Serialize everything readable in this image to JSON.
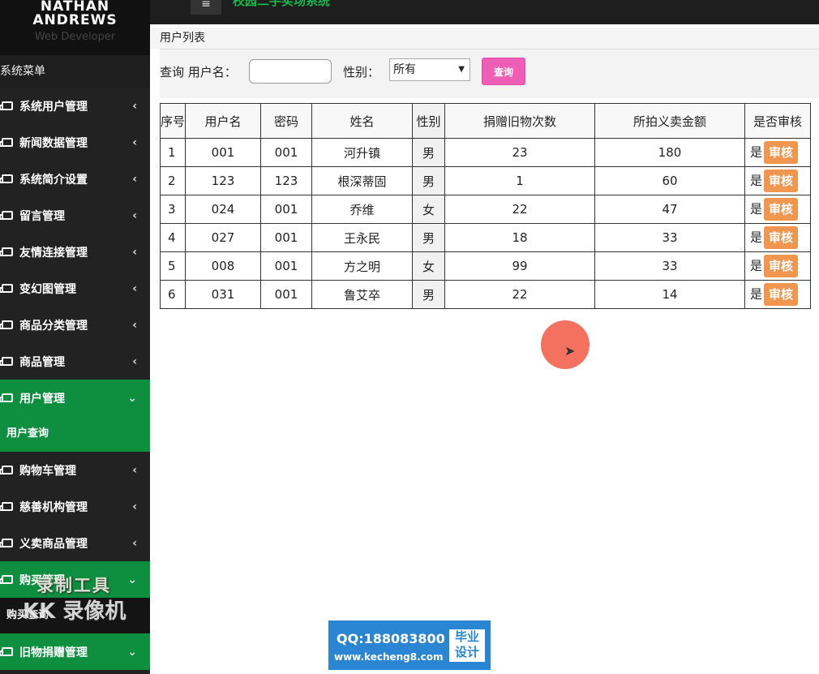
{
  "brand": {
    "name_line1": "NATHAN",
    "name_line2": "ANDREWS",
    "role": "Web Developer"
  },
  "topbar": {
    "toggle_icon": "≡",
    "title": "校园二手买场系统"
  },
  "sidebar": {
    "title": "系统菜单",
    "items": [
      {
        "label": "系统用户管理",
        "chevron": "‹"
      },
      {
        "label": "新闻数据管理",
        "chevron": "‹"
      },
      {
        "label": "系统简介设置",
        "chevron": "‹"
      },
      {
        "label": "留言管理",
        "chevron": "‹"
      },
      {
        "label": "友情连接管理",
        "chevron": "‹"
      },
      {
        "label": "变幻图管理",
        "chevron": "‹"
      },
      {
        "label": "商品分类管理",
        "chevron": "‹"
      },
      {
        "label": "商品管理",
        "chevron": "‹"
      },
      {
        "label": "用户管理",
        "chevron": "⌄",
        "sub": "用户查询"
      },
      {
        "label": "购物车管理",
        "chevron": "‹"
      },
      {
        "label": "慈善机构管理",
        "chevron": "‹"
      },
      {
        "label": "义卖商品管理",
        "chevron": "‹"
      },
      {
        "label": "购买管理",
        "chevron": "⌄",
        "sub": "购买查询"
      },
      {
        "label": "旧物捐赠管理",
        "chevron": "⌄"
      }
    ]
  },
  "breadcrumb": "用户列表",
  "filters": {
    "query_label": "查询 用户名：",
    "username_value": "",
    "gender_label": "性别：",
    "gender_selected": "所有",
    "query_button": "查询"
  },
  "table": {
    "headers": [
      "序号",
      "用户名",
      "密码",
      "姓名",
      "性别",
      "捐赠旧物次数",
      "所拍义卖金额",
      "是否审核"
    ],
    "rows": [
      {
        "seq": "1",
        "username": "001",
        "password": "001",
        "name": "河升镇",
        "gender": "男",
        "donations": "23",
        "amount": "180",
        "audited": "是",
        "action": "审核"
      },
      {
        "seq": "2",
        "username": "123",
        "password": "123",
        "name": "根深蒂固",
        "gender": "男",
        "donations": "1",
        "amount": "60",
        "audited": "是",
        "action": "审核"
      },
      {
        "seq": "3",
        "username": "024",
        "password": "001",
        "name": "乔维",
        "gender": "女",
        "donations": "22",
        "amount": "47",
        "audited": "是",
        "action": "审核"
      },
      {
        "seq": "4",
        "username": "027",
        "password": "001",
        "name": "王永民",
        "gender": "男",
        "donations": "18",
        "amount": "33",
        "audited": "是",
        "action": "审核"
      },
      {
        "seq": "5",
        "username": "008",
        "password": "001",
        "name": "方之明",
        "gender": "女",
        "donations": "99",
        "amount": "33",
        "audited": "是",
        "action": "审核"
      },
      {
        "seq": "6",
        "username": "031",
        "password": "001",
        "name": "鲁艾卒",
        "gender": "男",
        "donations": "22",
        "amount": "14",
        "audited": "是",
        "action": "审核"
      }
    ]
  },
  "watermarks": {
    "line1": "录制工具",
    "line2": "KK 录像机",
    "qq": "QQ:188083800",
    "site": "www.kecheng8.com",
    "tag": "毕业设计"
  },
  "colors": {
    "sidebar_bg": "#222222",
    "active_green": "#0e8f3f",
    "query_button": "#ef5eb6",
    "audit_button": "#f0964e"
  }
}
